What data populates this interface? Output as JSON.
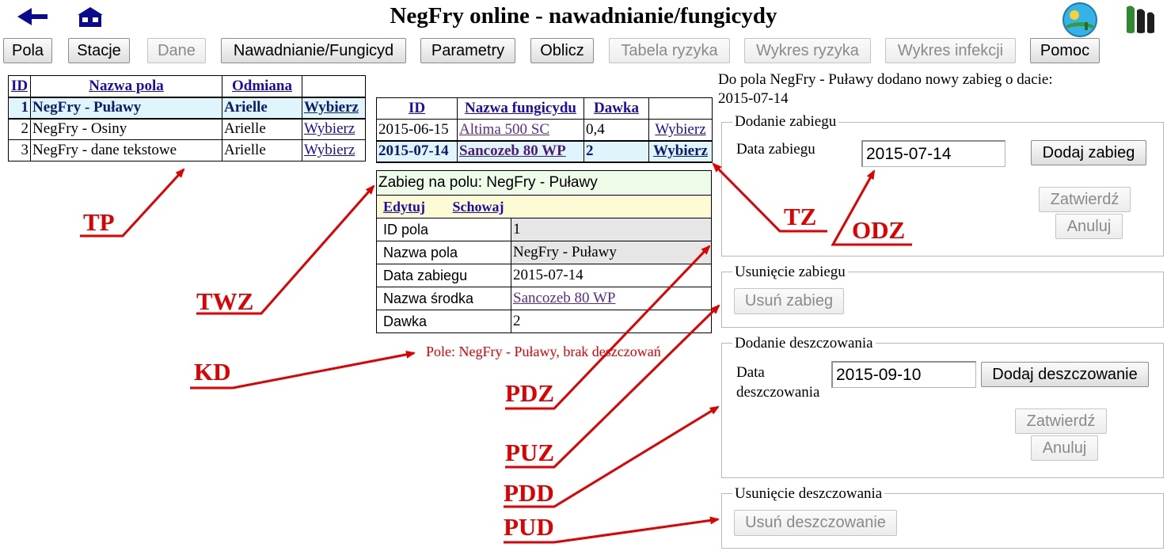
{
  "header": {
    "title": "NegFry online - nawadnianie/fungicydy"
  },
  "menu": [
    {
      "label": "Pola",
      "enabled": true
    },
    {
      "label": "Stacje",
      "enabled": true
    },
    {
      "label": "Dane",
      "enabled": false
    },
    {
      "label": "Nawadnianie/Fungicyd",
      "enabled": true
    },
    {
      "label": "Parametry",
      "enabled": true
    },
    {
      "label": "Oblicz",
      "enabled": true
    },
    {
      "label": "Tabela ryzyka",
      "enabled": false
    },
    {
      "label": "Wykres ryzyka",
      "enabled": false
    },
    {
      "label": "Wykres infekcji",
      "enabled": false
    },
    {
      "label": "Pomoc",
      "enabled": true
    }
  ],
  "fields_table": {
    "headers": [
      "ID",
      "Nazwa pola",
      "Odmiana",
      ""
    ],
    "rows": [
      {
        "id": "1",
        "name": "NegFry - Puławy",
        "variety": "Arielle",
        "action": "Wybierz"
      },
      {
        "id": "2",
        "name": "NegFry - Osiny",
        "variety": "Arielle",
        "action": "Wybierz"
      },
      {
        "id": "3",
        "name": "NegFry - dane tekstowe",
        "variety": "Arielle",
        "action": "Wybierz"
      }
    ]
  },
  "treatments_table": {
    "headers": [
      "ID",
      "Nazwa fungicydu",
      "Dawka",
      ""
    ],
    "rows": [
      {
        "id": "2015-06-15",
        "name": "Altima 500 SC",
        "dose": "0,4",
        "action": "Wybierz"
      },
      {
        "id": "2015-07-14",
        "name": "Sancozeb 80 WP",
        "dose": "2",
        "action": "Wybierz"
      }
    ]
  },
  "treatment_detail": {
    "title": "Zabieg na polu: NegFry - Puławy",
    "edit_link": "Edytuj",
    "hide_link": "Schowaj",
    "rows": [
      {
        "label": "ID pola",
        "value": "1"
      },
      {
        "label": "Nazwa pola",
        "value": "NegFry - Puławy"
      },
      {
        "label": "Data zabiegu",
        "value": "2015-07-14"
      },
      {
        "label": "Nazwa środka",
        "value": "Sancozeb 80 WP"
      },
      {
        "label": "Dawka",
        "value": "2"
      }
    ]
  },
  "irrigation_status": "Pole: NegFry - Puławy, brak deszczowań",
  "message": {
    "line1": "Do pola NegFry - Puławy dodano nowy zabieg o dacie:",
    "line2": "2015-07-14"
  },
  "add_treatment": {
    "legend": "Dodanie zabiegu",
    "date_label": "Data zabiegu",
    "date_value": "2015-07-14",
    "add_button": "Dodaj zabieg",
    "confirm_button": "Zatwierdź",
    "cancel_button": "Anuluj"
  },
  "delete_treatment": {
    "legend": "Usunięcie zabiegu",
    "button": "Usuń zabieg"
  },
  "add_irrigation": {
    "legend": "Dodanie deszczowania",
    "date_label_1": "Data",
    "date_label_2": "deszczowania",
    "date_value": "2015-09-10",
    "add_button": "Dodaj deszczowanie",
    "confirm_button": "Zatwierdź",
    "cancel_button": "Anuluj"
  },
  "delete_irrigation": {
    "legend": "Usunięcie deszczowania",
    "button": "Usuń deszczowanie"
  },
  "annotations": {
    "tp": "TP",
    "twz": "TWZ",
    "kd": "KD",
    "tz": "TZ",
    "odz": "ODZ",
    "pdz": "PDZ",
    "puz": "PUZ",
    "pdd": "PDD",
    "pud": "PUD"
  },
  "colors": {
    "annotation": "#e00000",
    "link": "#1a0dab",
    "selected_row": "#dff4fb",
    "detail_header": "#eefbe9",
    "detail_links_row": "#fdfbd3",
    "detail_value_grey": "#e6e6e6"
  },
  "icons": [
    "back-arrow-icon",
    "home-icon",
    "institute-logo",
    "iung-logo"
  ]
}
